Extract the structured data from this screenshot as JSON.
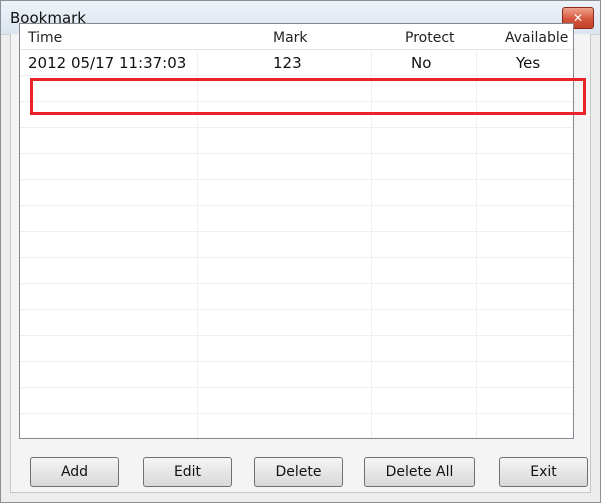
{
  "window": {
    "title": "Bookmark",
    "close_glyph": "✕"
  },
  "table": {
    "columns": [
      "Time",
      "Mark",
      "Protect",
      "Available"
    ],
    "rows": [
      {
        "time": "2012 05/17 11:37:03",
        "mark": "123",
        "protect": "No",
        "available": "Yes"
      }
    ]
  },
  "buttons": {
    "add": "Add",
    "edit": "Edit",
    "delete": "Delete",
    "delete_all": "Delete All",
    "exit": "Exit"
  },
  "colors": {
    "highlight": "#e8232a",
    "close_button": "#c9472e"
  }
}
